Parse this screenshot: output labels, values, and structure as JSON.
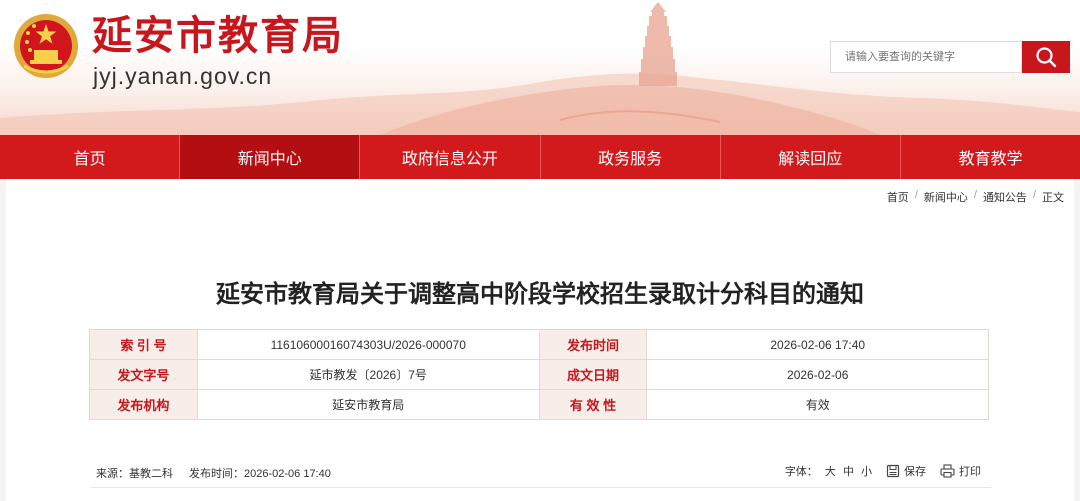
{
  "header": {
    "title": "延安市教育局",
    "domain": "jyj.yanan.gov.cn",
    "search_placeholder": "请输入要查询的关键字",
    "brand_color": "#c8161d"
  },
  "nav": {
    "items": [
      "首页",
      "新闻中心",
      "政府信息公开",
      "政务服务",
      "解读回应",
      "教育教学"
    ],
    "active_index": 1
  },
  "breadcrumb": [
    "首页",
    "新闻中心",
    "通知公告",
    "正文"
  ],
  "article": {
    "title": "延安市教育局关于调整高中阶段学校招生录取计分科目的通知"
  },
  "meta": {
    "index_label": "索 引 号",
    "index_value": "11610600016074303U/2026-000070",
    "publish_time_label": "发布时间",
    "publish_time_value": "2026-02-06 17:40",
    "doc_no_label": "发文字号",
    "doc_no_value": "延市教发〔2026〕7号",
    "created_label": "成文日期",
    "created_value": "2026-02-06",
    "org_label": "发布机构",
    "org_value": "延安市教育局",
    "validity_label": "有 效 性",
    "validity_value": "有效"
  },
  "info": {
    "source": "来源：基教二科",
    "publish": "发布时间：2026-02-06 17:40",
    "font_label": "字体：",
    "font_large": "大",
    "font_medium": "中",
    "font_small": "小",
    "save_label": "保存",
    "print_label": "打印"
  }
}
